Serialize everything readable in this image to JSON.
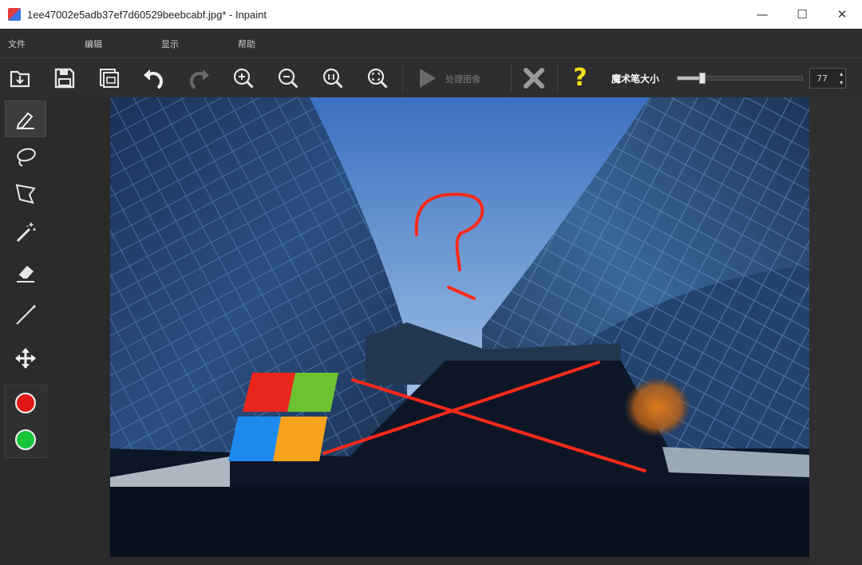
{
  "window": {
    "title": "1ee47002e5adb37ef7d60529beebcabf.jpg* - Inpaint",
    "minimize": "—",
    "maximize": "☐",
    "close": "✕"
  },
  "menu": {
    "items": [
      "文件",
      "编辑",
      "显示",
      "帮助"
    ]
  },
  "toolbar": {
    "process_label": "处理图像",
    "brush_size_label": "魔术笔大小",
    "brush_size_value": "77",
    "brush_size_fraction": 0.2,
    "help_glyph": "?",
    "accent_help": "#f2e21a"
  },
  "tools": {
    "items": [
      "marker-tool",
      "lasso-tool",
      "polygon-lasso-tool",
      "magic-wand-tool",
      "eraser-tool",
      "line-tool",
      "move-tool"
    ],
    "active": "marker-tool",
    "colors": [
      {
        "name": "red",
        "hex": "#e01818"
      },
      {
        "name": "green",
        "hex": "#18c43a"
      }
    ]
  },
  "canvas": {
    "logo_colors": [
      "#e8261c",
      "#6dc232",
      "#1e8af0",
      "#f7a21c"
    ],
    "annotation_color": "#ff2a1a",
    "orange_blob": "#e07a1a",
    "sky_top": "#3b6fc0",
    "sky_bottom": "#c9dcf0"
  }
}
